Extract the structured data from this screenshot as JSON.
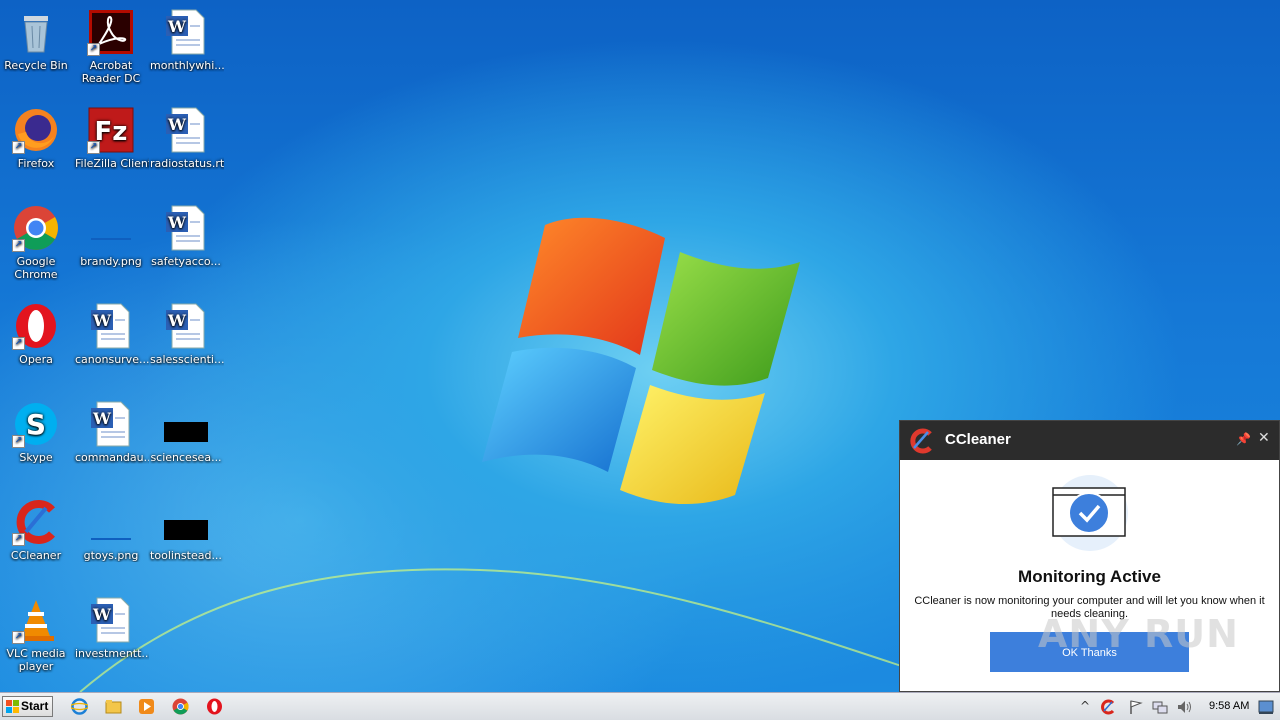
{
  "desktop": {
    "icons": [
      {
        "label": "Recycle Bin",
        "icon": "recycle-bin-icon"
      },
      {
        "label": "Acrobat Reader DC",
        "icon": "acrobat-icon"
      },
      {
        "label": "monthlywhi...",
        "icon": "word-doc-icon"
      },
      {
        "label": "Firefox",
        "icon": "firefox-icon"
      },
      {
        "label": "FileZilla Client",
        "icon": "filezilla-icon"
      },
      {
        "label": "radiostatus.rtf",
        "icon": "word-doc-icon"
      },
      {
        "label": "Google Chrome",
        "icon": "chrome-icon"
      },
      {
        "label": "brandy.png",
        "icon": "image-file-icon"
      },
      {
        "label": "safetyacco...",
        "icon": "word-doc-icon"
      },
      {
        "label": "Opera",
        "icon": "opera-icon"
      },
      {
        "label": "canonsurve...",
        "icon": "word-doc-icon"
      },
      {
        "label": "salesscienti...",
        "icon": "word-doc-icon"
      },
      {
        "label": "Skype",
        "icon": "skype-icon"
      },
      {
        "label": "commandau...",
        "icon": "word-doc-icon"
      },
      {
        "label": "sciencesea...",
        "icon": "black-file-icon"
      },
      {
        "label": "CCleaner",
        "icon": "ccleaner-icon"
      },
      {
        "label": "gtoys.png",
        "icon": "image-file-icon"
      },
      {
        "label": "toolinstead...",
        "icon": "black-file-icon"
      },
      {
        "label": "VLC media player",
        "icon": "vlc-icon"
      },
      {
        "label": "investmentt...",
        "icon": "word-doc-icon"
      }
    ]
  },
  "popup": {
    "title": "CCleaner",
    "heading": "Monitoring Active",
    "message": "CCleaner is now monitoring your computer and will let you know when it needs cleaning.",
    "button_label": "OK Thanks",
    "pin_icon": "pin-icon",
    "close_icon": "close-icon"
  },
  "watermark": "ANY RUN",
  "taskbar": {
    "start_label": "Start",
    "pinned": [
      "internet-explorer-icon",
      "explorer-folder-icon",
      "media-player-icon",
      "chrome-icon",
      "opera-icon"
    ],
    "tray": [
      "show-hidden-icons-chevron",
      "ccleaner-tray-icon",
      "action-center-flag-icon",
      "network-icon",
      "volume-icon"
    ],
    "clock": "9:58 AM"
  },
  "colors": {
    "popup_header": "#2c2c2c",
    "popup_button": "#3d7fdc",
    "desktop_blue": "#1578d6"
  }
}
